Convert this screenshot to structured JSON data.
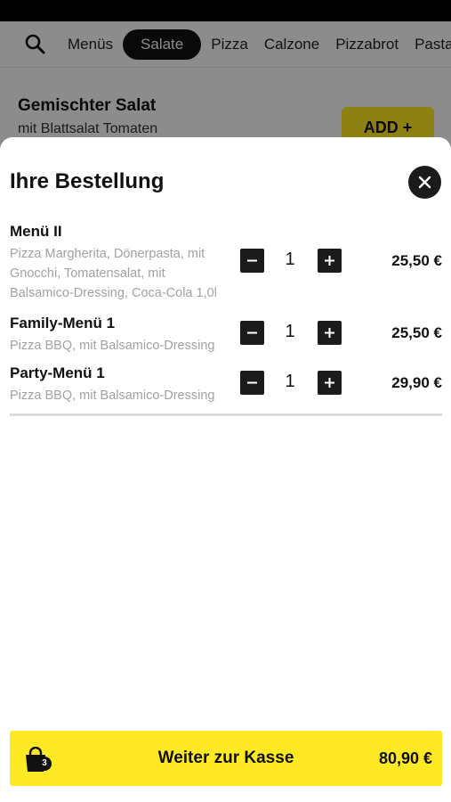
{
  "categories": {
    "items": [
      "Menüs",
      "Salate",
      "Pizza",
      "Calzone",
      "Pizzabrot",
      "Pasta"
    ],
    "active": "Salate"
  },
  "background_product": {
    "title": "Gemischter Salat",
    "description": "mit Blattsalat Tomaten",
    "add_label": "ADD +"
  },
  "order": {
    "title": "Ihre Bestellung",
    "items": [
      {
        "name": "Menü II",
        "description": "Pizza Margherita, Dönerpasta, mit\nGnocchi, Tomatensalat, mit\nBalsamico-Dressing, Coca-Cola 1,0l",
        "quantity": "1",
        "price": "25,50 €"
      },
      {
        "name": "Family-Menü 1",
        "description": "Pizza BBQ, mit Balsamico-Dressing",
        "quantity": "1",
        "price": "25,50 €"
      },
      {
        "name": "Party-Menü 1",
        "description": "Pizza BBQ, mit Balsamico-Dressing",
        "quantity": "1",
        "price": "29,90 €"
      }
    ]
  },
  "checkout": {
    "bag_count": "3",
    "label": "Weiter zur Kasse",
    "total": "80,90 €"
  },
  "colors": {
    "accent": "#ffe924",
    "dark": "#1b1b1b",
    "muted_text": "#a2a2a2"
  },
  "icons": {
    "search": "search-icon",
    "close": "close-icon",
    "minus": "minus-icon",
    "plus": "plus-icon",
    "bag": "shopping-bag-icon"
  }
}
